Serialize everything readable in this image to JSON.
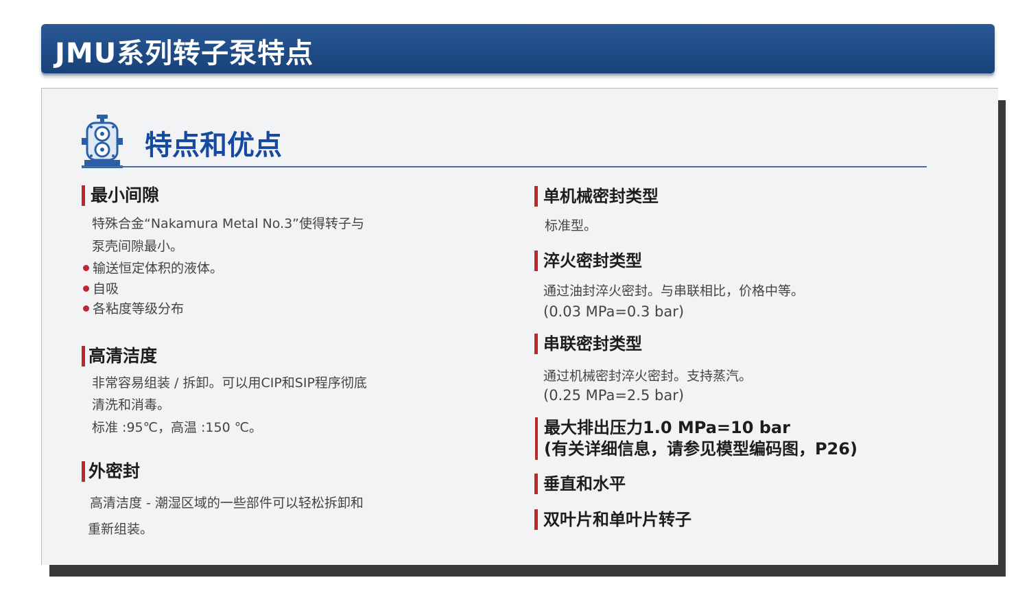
{
  "header": {
    "title": "JMU系列转子泵特点"
  },
  "section": {
    "title": "特点和优点",
    "icon": "rotary-pump-icon"
  },
  "left": {
    "min_gap": {
      "heading": "最小间隙",
      "lines": [
        "特殊合金“Nakamura Metal No.3”使得转子与",
        "泵壳间隙最小。"
      ],
      "bullets": [
        "输送恒定体积的液体。",
        "自吸",
        "各粘度等级分布"
      ]
    },
    "hygiene": {
      "heading": "高清洁度",
      "lines": [
        "非常容易组装 / 拆卸。可以用CIP和SIP程序彻底",
        "清洗和消毒。",
        "标准 :95℃，高温 :150 ℃。"
      ]
    },
    "outer_seal": {
      "heading": "外密封",
      "lines": [
        "高清洁度 - 潮湿区域的一些部件可以轻松拆卸和",
        "重新组装。"
      ]
    }
  },
  "right": {
    "single_seal": {
      "heading": "单机械密封类型",
      "lines": [
        "标准型。"
      ]
    },
    "quench_seal": {
      "heading": "淬火密封类型",
      "lines": [
        "通过油封淬火密封。与串联相比，价格中等。",
        "(0.03 MPa=0.3 bar)"
      ]
    },
    "tandem_seal": {
      "heading": "串联密封类型",
      "lines": [
        "通过机械密封淬火密封。支持蒸汽。",
        "(0.25 MPa=2.5 bar)"
      ]
    },
    "max_pressure": {
      "line1": "最大排出压力1.0 MPa=10 bar",
      "line2": "(有关详细信息，请参见模型编码图，P26)"
    },
    "orientation": {
      "heading": "垂直和水平"
    },
    "rotors": {
      "heading": "双叶片和单叶片转子"
    }
  },
  "colors": {
    "banner": "#1f4c87",
    "accent_red": "#c0272d",
    "title_blue": "#1749a0"
  }
}
